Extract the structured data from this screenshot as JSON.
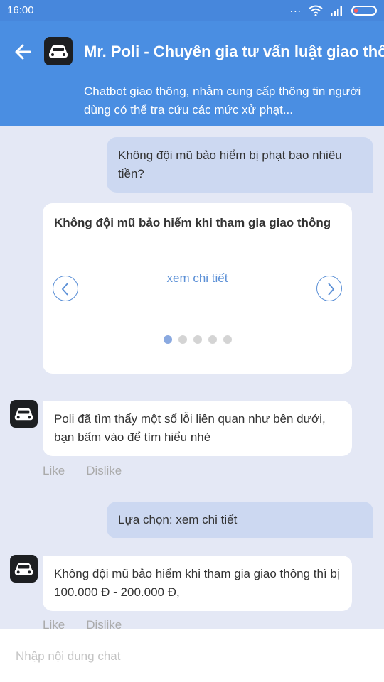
{
  "status_bar": {
    "time": "16:00",
    "more_indicator": "..."
  },
  "header": {
    "title": "Mr. Poli - Chuyên gia tư vấn luật giao thông",
    "subtitle": "Chatbot giao thông, nhằm cung cấp thông tin người dùng có thể tra cứu các mức xử phạt...",
    "avatar_icon": "car-icon",
    "back_icon": "arrow-left-icon"
  },
  "messages": {
    "user_question": "Không đội mũ bảo hiểm bị phạt bao nhiêu tiền?",
    "card": {
      "title": "Không đội mũ bảo hiểm khi tham gia giao thông",
      "link": "xem chi tiết",
      "pages": 5,
      "active_page": 1
    },
    "bot_reply_1": "Poli đã tìm thấy một số lỗi liên quan như bên dưới, bạn bấm vào để tìm hiểu nhé",
    "reactions_1": {
      "like": "Like",
      "dislike": "Dislike"
    },
    "user_choice": "Lựa chọn: xem chi tiết",
    "bot_reply_2": "Không đội mũ bảo hiểm khi tham gia giao thông thì bị 100.000 Đ - 200.000 Đ,",
    "reactions_2": {
      "like": "Like",
      "dislike": "Dislike"
    }
  },
  "input": {
    "placeholder": "Nhập nội dung chat"
  },
  "colors": {
    "header_bg": "#4a8ee2",
    "status_bg": "#4787dc",
    "chat_bg": "#e4e8f5",
    "user_bubble": "#ccd8f1",
    "accent": "#5a8fd6"
  }
}
